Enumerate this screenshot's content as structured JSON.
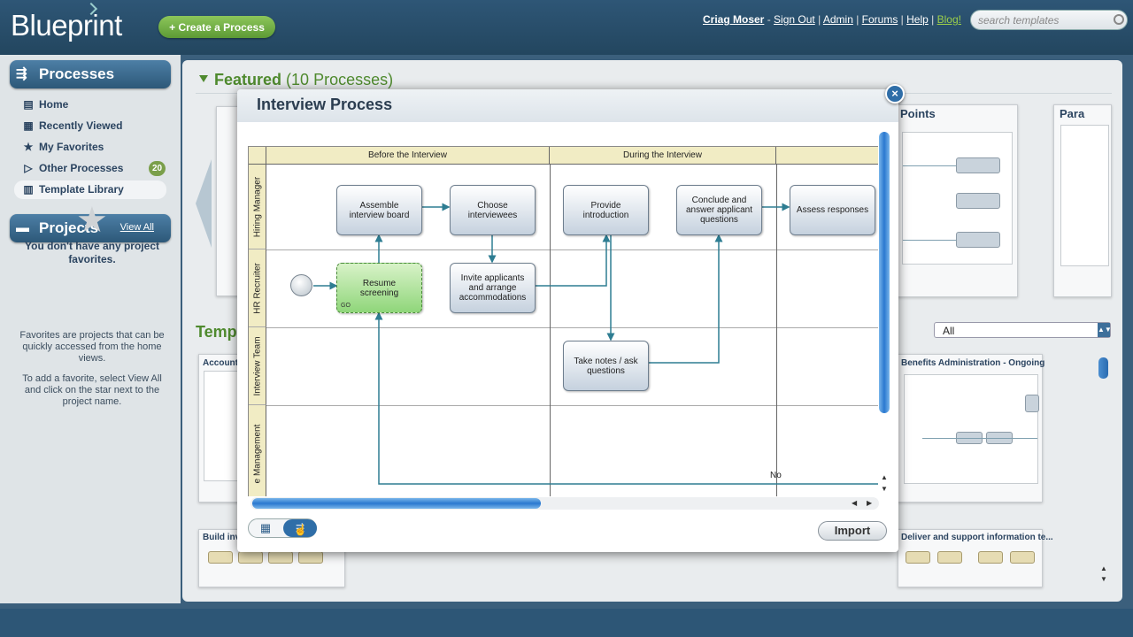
{
  "header": {
    "logo": "Blueprint",
    "create_button": "+ Create a Process",
    "user": "Criag Moser",
    "links": [
      "Sign Out",
      "Admin",
      "Forums",
      "Help"
    ],
    "blog": "Blog!",
    "search_placeholder": "search templates"
  },
  "sidebar": {
    "processes_title": "Processes",
    "items": [
      {
        "label": "Home",
        "icon": "home-icon"
      },
      {
        "label": "Recently Viewed",
        "icon": "calendar-icon"
      },
      {
        "label": "My Favorites",
        "icon": "star-icon"
      },
      {
        "label": "Other Processes",
        "icon": "play-icon",
        "badge": "20"
      },
      {
        "label": "Template Library",
        "icon": "library-icon",
        "active": true
      }
    ],
    "projects_title": "Projects",
    "view_all": "View All",
    "empty_title": "You don't have any project favorites.",
    "empty_text_1": "Favorites are projects that can be quickly accessed from the home views.",
    "empty_text_2": "To add a favorite, select View All and click on the star next to the project name."
  },
  "main": {
    "featured_title": "Featured",
    "featured_count": "(10 Processes)",
    "templates_title": "Temp",
    "featured_cards": [
      {
        "title": "Points"
      },
      {
        "title": "Para"
      }
    ],
    "template_cards": [
      {
        "title": "Accounti"
      },
      {
        "title": "Benefits Administration - Ongoing"
      },
      {
        "title": "Build inve"
      },
      {
        "title": "Deliver and support information te..."
      }
    ],
    "filter_value": "All"
  },
  "modal": {
    "title": "Interview Process",
    "close": "×",
    "import_button": "Import",
    "phases": [
      "Before the Interview",
      "During the Interview"
    ],
    "lanes": [
      "Hiring Manager",
      "HR Recruiter",
      "Interview Team",
      "e Management"
    ],
    "tasks": {
      "assemble": "Assemble interview board",
      "choose": "Choose interviewees",
      "provide": "Provide introduction",
      "conclude": "Conclude and answer applicant questions",
      "assess": "Assess responses",
      "resume": "Resume screening",
      "resume_tag": "GO",
      "invite": "Invite applicants and arrange accommodations",
      "notes": "Take notes / ask questions"
    },
    "no_label": "No"
  }
}
